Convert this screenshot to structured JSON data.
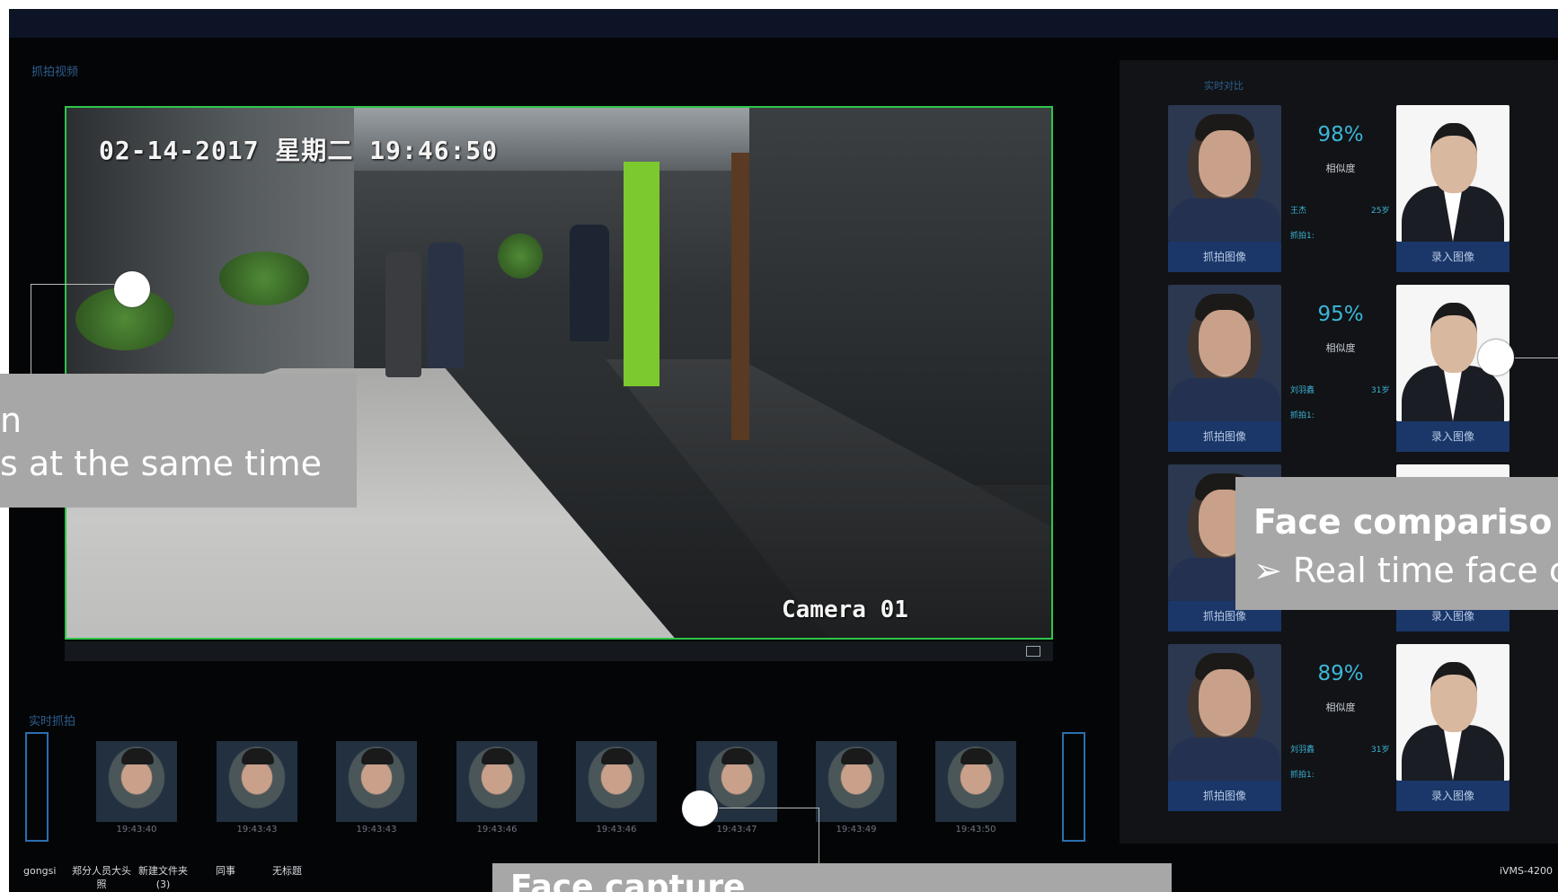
{
  "labels": {
    "video_section": "抓拍视频",
    "compare_section": "实时对比",
    "strip_section": "实时抓拍"
  },
  "video": {
    "timestamp": "02-14-2017 星期二 19:46:50",
    "camera": "Camera 01"
  },
  "comparisons": [
    {
      "percent": "98%",
      "similarity_label": "相似度",
      "name": "王杰",
      "age": "25岁",
      "snap_note": "抓拍1:",
      "capture_btn": "抓拍图像",
      "register_btn": "录入图像"
    },
    {
      "percent": "95%",
      "similarity_label": "相似度",
      "name": "刘羽鑫",
      "age": "31岁",
      "snap_note": "抓拍1:",
      "capture_btn": "抓拍图像",
      "register_btn": "录入图像"
    },
    {
      "percent": "",
      "similarity_label": "",
      "name": "",
      "age": "",
      "snap_note": "",
      "capture_btn": "抓拍图像",
      "register_btn": "录入图像"
    },
    {
      "percent": "89%",
      "similarity_label": "相似度",
      "name": "刘羽鑫",
      "age": "31岁",
      "snap_note": "抓拍1:",
      "capture_btn": "抓拍图像",
      "register_btn": "录入图像"
    }
  ],
  "snapshots": [
    {
      "time": "19:43:40"
    },
    {
      "time": "19:43:43"
    },
    {
      "time": "19:43:43"
    },
    {
      "time": "19:43:46"
    },
    {
      "time": "19:43:46"
    },
    {
      "time": "19:43:47"
    },
    {
      "time": "19:43:49"
    },
    {
      "time": "19:43:50"
    }
  ],
  "folders": [
    {
      "line1": "gongsi",
      "line2": ""
    },
    {
      "line1": "郑分人员大头",
      "line2": "照"
    },
    {
      "line1": "新建文件夹",
      "line2": "(3)"
    },
    {
      "line1": "同事",
      "line2": ""
    },
    {
      "line1": "无标题",
      "line2": ""
    }
  ],
  "app_name": "iVMS-4200",
  "callouts": {
    "left_line1": "n",
    "left_line2": "s at the same time",
    "right_title": "Face compariso",
    "right_sub": "➢  Real time face c",
    "bottom_title": "Face capture"
  }
}
